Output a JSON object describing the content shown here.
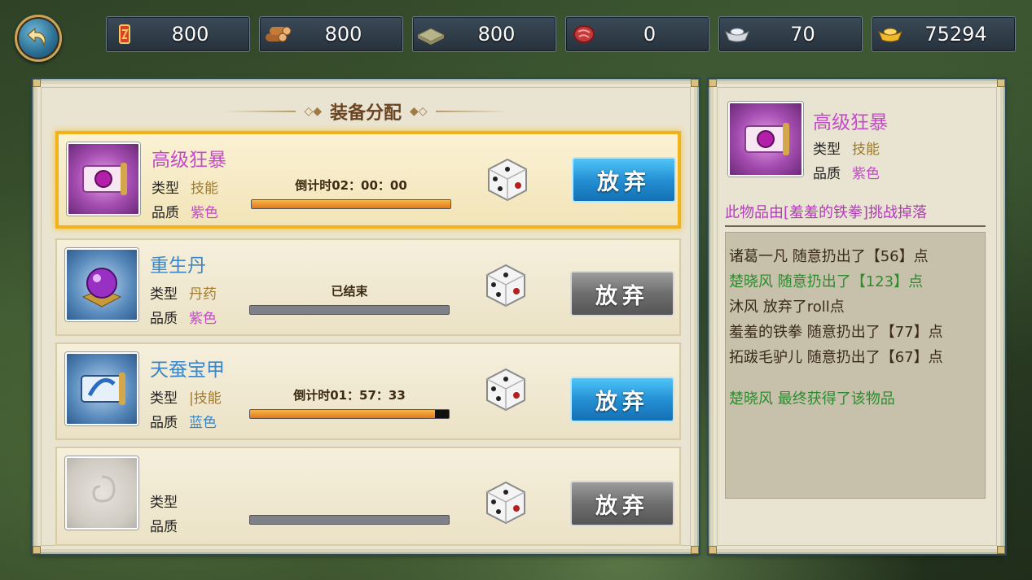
{
  "resources": [
    {
      "icon": "scroll-order-icon",
      "value": "800"
    },
    {
      "icon": "wood-logs-icon",
      "value": "800"
    },
    {
      "icon": "stone-slab-icon",
      "value": "800"
    },
    {
      "icon": "meat-icon",
      "value": "0"
    },
    {
      "icon": "silver-ingot-icon",
      "value": "70"
    },
    {
      "icon": "gold-ingot-icon",
      "value": "75294"
    }
  ],
  "panel": {
    "title": "装备分配"
  },
  "items": [
    {
      "name": "高级狂暴",
      "name_color": "#c34bc8",
      "type_label": "类型",
      "type_value": "技能",
      "quality_label": "品质",
      "quality_value": "紫色",
      "quality_color": "#c34bc8",
      "timer": "倒计时02：00：00",
      "progress": 1.0,
      "button": "放弃",
      "button_state": "active"
    },
    {
      "name": "重生丹",
      "name_color": "#3a86c8",
      "type_label": "类型",
      "type_value": "丹药",
      "quality_label": "品质",
      "quality_value": "紫色",
      "quality_color": "#c34bc8",
      "timer": "已结束",
      "progress": 0.0,
      "button": "放弃",
      "button_state": "disabled"
    },
    {
      "name": "天蚕宝甲",
      "name_color": "#3a86c8",
      "type_label": "类型",
      "type_value": "|技能",
      "quality_label": "品质",
      "quality_value": "蓝色",
      "quality_color": "#3a86c8",
      "timer": "倒计时01：57：33",
      "progress": 0.93,
      "button": "放弃",
      "button_state": "active"
    },
    {
      "name": "",
      "name_color": "#3a86c8",
      "type_label": "类型",
      "type_value": "",
      "quality_label": "品质",
      "quality_value": "",
      "quality_color": "#c34bc8",
      "timer": "",
      "progress": 0.0,
      "button": "放弃",
      "button_state": "disabled"
    }
  ],
  "detail": {
    "name": "高级狂暴",
    "type_label": "类型",
    "type_value": "技能",
    "quality_label": "品质",
    "quality_value": "紫色",
    "source": "此物品由[羞羞的铁拳]挑战掉落",
    "log": [
      {
        "text": "诸葛一凡  随意扔出了【56】点",
        "color": "#3a2a1a"
      },
      {
        "text": "楚晓风  随意扔出了【123】点",
        "color": "#2f8a2f"
      },
      {
        "text": "沐风  放弃了roll点",
        "color": "#3a2a1a"
      },
      {
        "text": "羞羞的铁拳  随意扔出了【77】点",
        "color": "#3a2a1a"
      },
      {
        "text": "拓跋毛驴儿  随意扔出了【67】点",
        "color": "#3a2a1a"
      },
      {
        "text": "楚晓风 最终获得了该物品",
        "color": "#2f8a2f"
      }
    ]
  },
  "colors": {
    "accent_gold": "#f2b21b",
    "brown": "#6b4422",
    "type_color": "#a07a2a"
  }
}
